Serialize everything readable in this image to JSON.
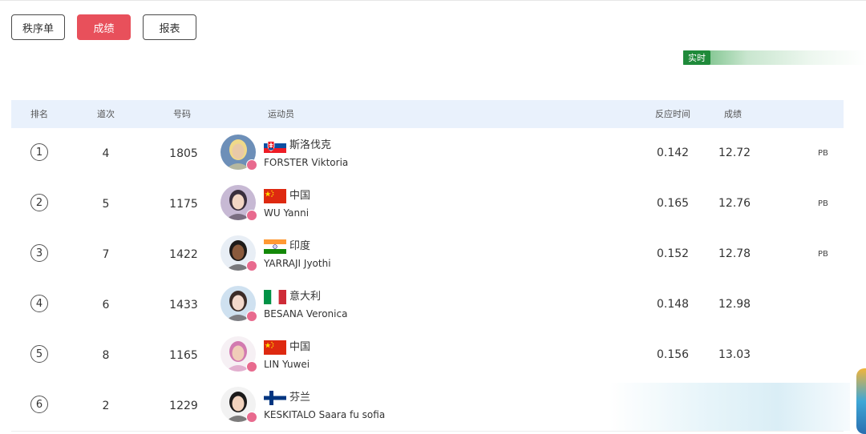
{
  "tabs": [
    {
      "label": "秩序单",
      "active": false
    },
    {
      "label": "成绩",
      "active": true
    },
    {
      "label": "报表",
      "active": false
    }
  ],
  "live_label": "实时",
  "colors": {
    "accent": "#e8505b",
    "live_green": "#1f8a3a",
    "header_bg": "#e9f1fc"
  },
  "table": {
    "headers": {
      "rank": "排名",
      "lane": "道次",
      "bib": "号码",
      "athlete": "运动员",
      "reaction": "反应时间",
      "result": "成绩"
    },
    "rows": [
      {
        "rank": "1",
        "lane": "4",
        "bib": "1805",
        "flag": "slovakia-flag-icon",
        "country": "斯洛伐克",
        "name": "FORSTER Viktoria",
        "reaction": "0.142",
        "result": "12.72",
        "note": "PB"
      },
      {
        "rank": "2",
        "lane": "5",
        "bib": "1175",
        "flag": "china-flag-icon",
        "country": "中国",
        "name": "WU Yanni",
        "reaction": "0.165",
        "result": "12.76",
        "note": "PB"
      },
      {
        "rank": "3",
        "lane": "7",
        "bib": "1422",
        "flag": "india-flag-icon",
        "country": "印度",
        "name": "YARRAJI Jyothi",
        "reaction": "0.152",
        "result": "12.78",
        "note": "PB"
      },
      {
        "rank": "4",
        "lane": "6",
        "bib": "1433",
        "flag": "italy-flag-icon",
        "country": "意大利",
        "name": "BESANA Veronica",
        "reaction": "0.148",
        "result": "12.98",
        "note": ""
      },
      {
        "rank": "5",
        "lane": "8",
        "bib": "1165",
        "flag": "china-flag-icon",
        "country": "中国",
        "name": "LIN Yuwei",
        "reaction": "0.156",
        "result": "13.03",
        "note": ""
      },
      {
        "rank": "6",
        "lane": "2",
        "bib": "1229",
        "flag": "finland-flag-icon",
        "country": "芬兰",
        "name": "KESKITALO Saara fu sofia",
        "reaction": "",
        "result": "",
        "note": ""
      }
    ]
  }
}
